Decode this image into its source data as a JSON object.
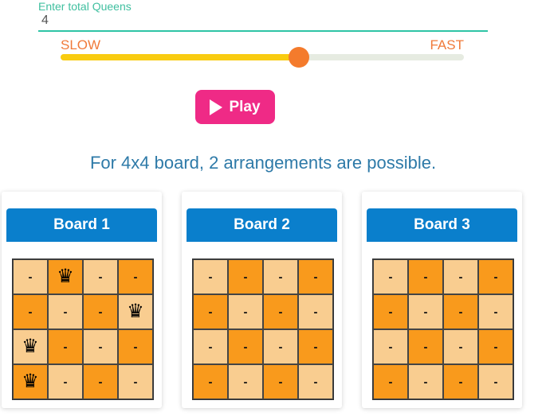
{
  "input": {
    "label": "Enter total Queens",
    "value": "4"
  },
  "speed": {
    "slow_label": "SLOW",
    "fast_label": "FAST",
    "value_percent": 59
  },
  "play_button": {
    "label": "Play",
    "icon": "play-icon"
  },
  "result": {
    "text": "For 4x4 board, 2 arrangements are possible."
  },
  "colors": {
    "light_cell": "#f9cd90",
    "dark_cell": "#f99a1c",
    "header": "#0a7fcc",
    "play": "#ef2a86",
    "slider_thumb": "#f47b2c",
    "slider_fill": "#f9cc10"
  },
  "empty_mark": "-",
  "queen_glyph": "♛",
  "boards": [
    {
      "title": "Board 1",
      "rows": [
        [
          "-",
          "Q",
          "-",
          "-"
        ],
        [
          "-",
          "-",
          "-",
          "Q"
        ],
        [
          "Q",
          "-",
          "-",
          "-"
        ],
        [
          "Q",
          "-",
          "-",
          "-"
        ]
      ]
    },
    {
      "title": "Board 2",
      "rows": [
        [
          "-",
          "-",
          "-",
          "-"
        ],
        [
          "-",
          "-",
          "-",
          "-"
        ],
        [
          "-",
          "-",
          "-",
          "-"
        ],
        [
          "-",
          "-",
          "-",
          "-"
        ]
      ]
    },
    {
      "title": "Board 3",
      "rows": [
        [
          "-",
          "-",
          "-",
          "-"
        ],
        [
          "-",
          "-",
          "-",
          "-"
        ],
        [
          "-",
          "-",
          "-",
          "-"
        ],
        [
          "-",
          "-",
          "-",
          "-"
        ]
      ]
    }
  ]
}
